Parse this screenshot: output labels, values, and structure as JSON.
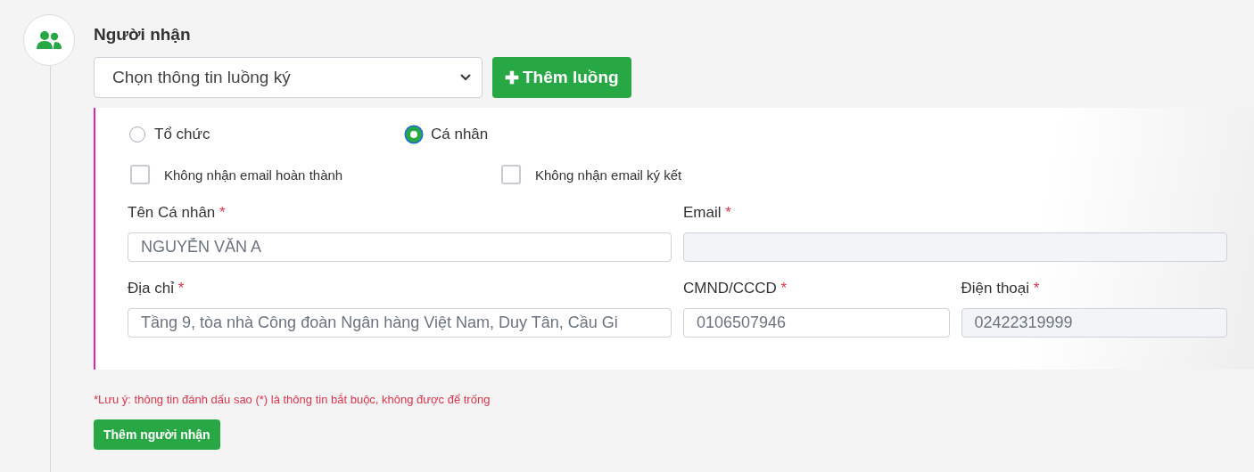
{
  "section": {
    "title": "Người nhận"
  },
  "flow_select": {
    "value": "Chọn thông tin luồng ký"
  },
  "add_flow_button": {
    "icon": "✚",
    "label": "Thêm luồng"
  },
  "recipient_type": [
    {
      "label": "Tổ chức",
      "selected": false
    },
    {
      "label": "Cá nhân",
      "selected": true
    }
  ],
  "options": [
    {
      "label": "Không nhận email hoàn thành",
      "checked": false
    },
    {
      "label": "Không nhận email ký kết",
      "checked": false
    }
  ],
  "fields": [
    {
      "label": "Tên Cá nhân",
      "required": "*",
      "value": "NGUYỄN VĂN A",
      "disabled": false
    },
    {
      "label": "Email",
      "required": "*",
      "disabled": true
    },
    {
      "label": "Địa chỉ",
      "required": "*",
      "value": "Tầng 9, tòa nhà Công đoàn Ngân hàng Việt Nam, Duy Tân, Cầu Gi",
      "disabled": false
    },
    {
      "label": "CMND/CCCD",
      "required": "*",
      "value": "0106507946",
      "disabled": false
    },
    {
      "label": "Điện thoại",
      "required": "*",
      "value": "02422319999",
      "disabled": true
    }
  ],
  "note": "*Lưu ý: thông tin đánh dấu sao (*) là thông tin bắt buộc, không được để trống",
  "add_recipient_button": {
    "label": "Thêm người nhận"
  }
}
